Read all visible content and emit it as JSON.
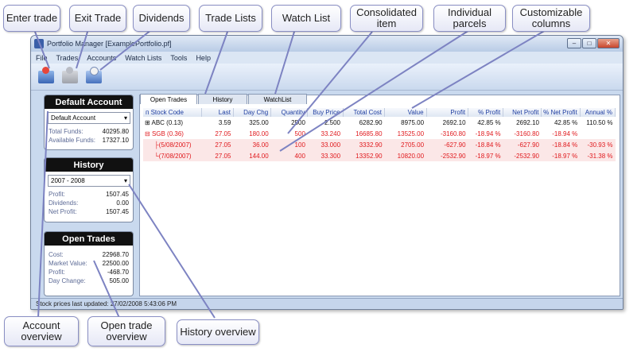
{
  "callouts": {
    "enter_trade": "Enter trade",
    "exit_trade": "Exit Trade",
    "dividends": "Dividends",
    "trade_lists": "Trade Lists",
    "watch_list": "Watch List",
    "consolidated_item": "Consolidated item",
    "individual_parcels": "Individual parcels",
    "customizable_columns": "Customizable columns",
    "account_overview": "Account overview",
    "open_trade_overview": "Open trade overview",
    "history_overview": "History overview"
  },
  "window": {
    "title": "Portfolio Manager [ExamplePortfolio.pf]",
    "menu": [
      "File",
      "Trades",
      "Accounts",
      "Watch Lists",
      "Tools",
      "Help"
    ],
    "toolbar": [
      "enter-trade-icon",
      "exit-trade-icon",
      "dividends-icon"
    ],
    "status": "Stock prices last updated: 27/02/2008 5:43:06 PM"
  },
  "default_account": {
    "header": "Default Account",
    "selected": "Default Account",
    "rows": [
      {
        "label": "Total Funds:",
        "value": "40295.80"
      },
      {
        "label": "Available Funds:",
        "value": "17327.10"
      }
    ]
  },
  "history": {
    "header": "History",
    "selected": "2007 - 2008",
    "rows": [
      {
        "label": "Profit:",
        "value": "1507.45"
      },
      {
        "label": "Dividends:",
        "value": "0.00"
      },
      {
        "label": "Net Profit:",
        "value": "1507.45"
      }
    ]
  },
  "open_trades_panel": {
    "header": "Open Trades",
    "rows": [
      {
        "label": "Cost:",
        "value": "22968.70"
      },
      {
        "label": "Market Value:",
        "value": "22500.00"
      },
      {
        "label": "Profit:",
        "value": "-468.70"
      },
      {
        "label": "Day Change:",
        "value": "505.00"
      }
    ]
  },
  "tabs": [
    "Open Trades",
    "History",
    "WatchList"
  ],
  "table": {
    "columns": [
      "Stock Code",
      "Last",
      "Day Chg",
      "Quantity",
      "Buy Price",
      "Total Cost",
      "Value",
      "Profit",
      "% Profit",
      "Net Profit",
      "% Net Profit",
      "Annual %"
    ],
    "rows": [
      [
        "ABC (0.13)",
        "3.59",
        "325.00",
        "2500",
        "2.500",
        "6282.90",
        "8975.00",
        "2692.10",
        "42.85 %",
        "2692.10",
        "42.85 %",
        "110.50 %"
      ],
      [
        "SGB (0.36)",
        "27.05",
        "180.00",
        "500",
        "33.240",
        "16685.80",
        "13525.00",
        "-3160.80",
        "-18.94 %",
        "-3160.80",
        "-18.94 %",
        ""
      ],
      [
        "(5/08/2007)",
        "27.05",
        "36.00",
        "100",
        "33.000",
        "3332.90",
        "2705.00",
        "-627.90",
        "-18.84 %",
        "-627.90",
        "-18.84 %",
        "-30.93 %"
      ],
      [
        "(7/08/2007)",
        "27.05",
        "144.00",
        "400",
        "33.300",
        "13352.90",
        "10820.00",
        "-2532.90",
        "-18.97 %",
        "-2532.90",
        "-18.97 %",
        "-31.38 %"
      ]
    ]
  }
}
